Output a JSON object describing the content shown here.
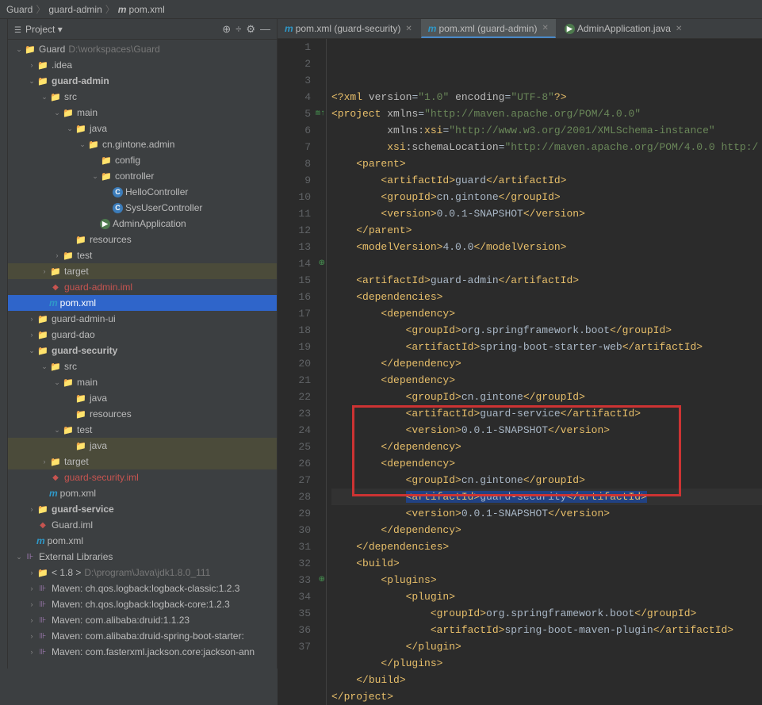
{
  "breadcrumb": {
    "parts": [
      "Guard",
      "guard-admin",
      "pom.xml"
    ]
  },
  "panel": {
    "title": "Project",
    "icons": [
      "target",
      "sync",
      "gear",
      "minimize"
    ]
  },
  "tree": [
    {
      "d": 0,
      "arrow": "v",
      "icon": "folder-blue",
      "label": "Guard",
      "dim": "D:\\workspaces\\Guard"
    },
    {
      "d": 1,
      "arrow": ">",
      "icon": "folder",
      "label": ".idea"
    },
    {
      "d": 1,
      "arrow": "v",
      "icon": "folder-blue",
      "label": "guard-admin",
      "bold": true
    },
    {
      "d": 2,
      "arrow": "v",
      "icon": "folder-blue",
      "label": "src"
    },
    {
      "d": 3,
      "arrow": "v",
      "icon": "folder-blue",
      "label": "main"
    },
    {
      "d": 4,
      "arrow": "v",
      "icon": "folder-blue",
      "label": "java"
    },
    {
      "d": 5,
      "arrow": "v",
      "icon": "folder",
      "label": "cn.gintone.admin"
    },
    {
      "d": 6,
      "arrow": "",
      "icon": "folder",
      "label": "config"
    },
    {
      "d": 6,
      "arrow": "v",
      "icon": "folder",
      "label": "controller"
    },
    {
      "d": 7,
      "arrow": "",
      "icon": "class-blue",
      "label": "HelloController"
    },
    {
      "d": 7,
      "arrow": "",
      "icon": "class-blue",
      "label": "SysUserController"
    },
    {
      "d": 6,
      "arrow": "",
      "icon": "class-green",
      "label": "AdminApplication"
    },
    {
      "d": 4,
      "arrow": "",
      "icon": "folder",
      "label": "resources"
    },
    {
      "d": 3,
      "arrow": ">",
      "icon": "folder-blue",
      "label": "test"
    },
    {
      "d": 2,
      "arrow": ">",
      "icon": "folder-orange",
      "label": "target",
      "hl": true
    },
    {
      "d": 2,
      "arrow": "",
      "icon": "iml",
      "label": "guard-admin.iml",
      "color": "#c75450"
    },
    {
      "d": 2,
      "arrow": "",
      "icon": "m",
      "label": "pom.xml",
      "selected": true
    },
    {
      "d": 1,
      "arrow": ">",
      "icon": "folder-blue",
      "label": "guard-admin-ui"
    },
    {
      "d": 1,
      "arrow": ">",
      "icon": "folder-blue",
      "label": "guard-dao"
    },
    {
      "d": 1,
      "arrow": "v",
      "icon": "folder-blue",
      "label": "guard-security",
      "bold": true
    },
    {
      "d": 2,
      "arrow": "v",
      "icon": "folder-blue",
      "label": "src"
    },
    {
      "d": 3,
      "arrow": "v",
      "icon": "folder-blue",
      "label": "main"
    },
    {
      "d": 4,
      "arrow": "",
      "icon": "folder-blue",
      "label": "java"
    },
    {
      "d": 4,
      "arrow": "",
      "icon": "folder",
      "label": "resources"
    },
    {
      "d": 3,
      "arrow": "v",
      "icon": "folder-blue",
      "label": "test"
    },
    {
      "d": 4,
      "arrow": "",
      "icon": "folder-blue",
      "label": "java",
      "hl": true
    },
    {
      "d": 2,
      "arrow": ">",
      "icon": "folder-orange",
      "label": "target",
      "hl": true
    },
    {
      "d": 2,
      "arrow": "",
      "icon": "iml",
      "label": "guard-security.iml",
      "color": "#c75450"
    },
    {
      "d": 2,
      "arrow": "",
      "icon": "m",
      "label": "pom.xml"
    },
    {
      "d": 1,
      "arrow": ">",
      "icon": "folder-blue",
      "label": "guard-service",
      "bold": true
    },
    {
      "d": 1,
      "arrow": "",
      "icon": "iml",
      "label": "Guard.iml"
    },
    {
      "d": 1,
      "arrow": "",
      "icon": "m",
      "label": "pom.xml"
    },
    {
      "d": 0,
      "arrow": "v",
      "icon": "lib",
      "label": "External Libraries"
    },
    {
      "d": 1,
      "arrow": ">",
      "icon": "folder",
      "label": "< 1.8 >",
      "dim": "D:\\program\\Java\\jdk1.8.0_111"
    },
    {
      "d": 1,
      "arrow": ">",
      "icon": "lib",
      "label": "Maven: ch.qos.logback:logback-classic:1.2.3"
    },
    {
      "d": 1,
      "arrow": ">",
      "icon": "lib",
      "label": "Maven: ch.qos.logback:logback-core:1.2.3"
    },
    {
      "d": 1,
      "arrow": ">",
      "icon": "lib",
      "label": "Maven: com.alibaba:druid:1.1.23"
    },
    {
      "d": 1,
      "arrow": ">",
      "icon": "lib",
      "label": "Maven: com.alibaba:druid-spring-boot-starter:"
    },
    {
      "d": 1,
      "arrow": ">",
      "icon": "lib",
      "label": "Maven: com.fasterxml.jackson.core:jackson-ann"
    }
  ],
  "tabs": [
    {
      "icon": "m",
      "label": "pom.xml (guard-security)",
      "active": false
    },
    {
      "icon": "m",
      "label": "pom.xml (guard-admin)",
      "active": true
    },
    {
      "icon": "class-green",
      "label": "AdminApplication.java",
      "active": false
    }
  ],
  "code": {
    "lines": [
      {
        "n": 1,
        "h": "<span class='tag'>&lt;?xml</span> <span class='attr'>version</span>=<span class='str'>\"1.0\"</span> <span class='attr'>encoding</span>=<span class='str'>\"UTF-8\"</span><span class='tag'>?&gt;</span>"
      },
      {
        "n": 2,
        "h": "<span class='tag'>&lt;project</span> <span class='attr'>xmlns</span>=<span class='str'>\"http://maven.apache.org/POM/4.0.0\"</span>"
      },
      {
        "n": 3,
        "h": "         <span class='attr'>xmlns:</span><span class='tag'>xsi</span>=<span class='str'>\"http://www.w3.org/2001/XMLSchema-instance\"</span>"
      },
      {
        "n": 4,
        "h": "         <span class='tag'>xsi</span><span class='attr'>:schemaLocation</span>=<span class='str'>\"http://maven.apache.org/POM/4.0.0 http:/</span>"
      },
      {
        "n": 5,
        "h": "    <span class='tag'>&lt;parent&gt;</span>",
        "marker": "m↑"
      },
      {
        "n": 6,
        "h": "        <span class='tag'>&lt;artifactId&gt;</span>guard<span class='tag'>&lt;/artifactId&gt;</span>"
      },
      {
        "n": 7,
        "h": "        <span class='tag'>&lt;groupId&gt;</span>cn.gintone<span class='tag'>&lt;/groupId&gt;</span>"
      },
      {
        "n": 8,
        "h": "        <span class='tag'>&lt;version&gt;</span>0.0.1-SNAPSHOT<span class='tag'>&lt;/version&gt;</span>"
      },
      {
        "n": 9,
        "h": "    <span class='tag'>&lt;/parent&gt;</span>"
      },
      {
        "n": 10,
        "h": "    <span class='tag'>&lt;modelVersion&gt;</span>4.0.0<span class='tag'>&lt;/modelVersion&gt;</span>"
      },
      {
        "n": 11,
        "h": ""
      },
      {
        "n": 12,
        "h": "    <span class='tag'>&lt;artifactId&gt;</span>guard-admin<span class='tag'>&lt;/artifactId&gt;</span>"
      },
      {
        "n": 13,
        "h": "    <span class='tag'>&lt;dependencies&gt;</span>"
      },
      {
        "n": 14,
        "h": "        <span class='tag'>&lt;dependency&gt;</span>",
        "marker": "⊕"
      },
      {
        "n": 15,
        "h": "            <span class='tag'>&lt;groupId&gt;</span>org.springframework.boot<span class='tag'>&lt;/groupId&gt;</span>"
      },
      {
        "n": 16,
        "h": "            <span class='tag'>&lt;artifactId&gt;</span>spring-boot-starter-web<span class='tag'>&lt;/artifactId&gt;</span>"
      },
      {
        "n": 17,
        "h": "        <span class='tag'>&lt;/dependency&gt;</span>"
      },
      {
        "n": 18,
        "h": "        <span class='tag'>&lt;dependency&gt;</span>"
      },
      {
        "n": 19,
        "h": "            <span class='tag'>&lt;groupId&gt;</span>cn.gintone<span class='tag'>&lt;/groupId&gt;</span>"
      },
      {
        "n": 20,
        "h": "            <span class='tag'>&lt;artifactId&gt;</span>guard-service<span class='tag'>&lt;/artifactId&gt;</span>"
      },
      {
        "n": 21,
        "h": "            <span class='tag'>&lt;version&gt;</span>0.0.1-SNAPSHOT<span class='tag'>&lt;/version&gt;</span>"
      },
      {
        "n": 22,
        "h": "        <span class='tag'>&lt;/dependency&gt;</span>"
      },
      {
        "n": 23,
        "h": "        <span class='tag'>&lt;dependency&gt;</span>"
      },
      {
        "n": 24,
        "h": "            <span class='tag'>&lt;groupId&gt;</span>cn.gintone<span class='tag'>&lt;/groupId&gt;</span>"
      },
      {
        "n": 25,
        "h": "            <span class='sel'><span class='tag'>&lt;artifactId&gt;</span>guard-security<span class='tag'>&lt;/artifactId&gt;</span></span>",
        "caret": true
      },
      {
        "n": 26,
        "h": "            <span class='tag'>&lt;version&gt;</span>0.0.1-SNAPSHOT<span class='tag'>&lt;/version&gt;</span>"
      },
      {
        "n": 27,
        "h": "        <span class='tag'>&lt;/dependency&gt;</span>"
      },
      {
        "n": 28,
        "h": "    <span class='tag'>&lt;/dependencies&gt;</span>"
      },
      {
        "n": 29,
        "h": "    <span class='tag'>&lt;build&gt;</span>"
      },
      {
        "n": 30,
        "h": "        <span class='tag'>&lt;plugins&gt;</span>"
      },
      {
        "n": 31,
        "h": "            <span class='tag'>&lt;plugin&gt;</span>"
      },
      {
        "n": 32,
        "h": "                <span class='tag'>&lt;groupId&gt;</span>org.springframework.boot<span class='tag'>&lt;/groupId&gt;</span>"
      },
      {
        "n": 33,
        "h": "                <span class='tag'>&lt;artifactId&gt;</span>spring-boot-maven-plugin<span class='tag'>&lt;/artifactId&gt;</span>",
        "marker": "⊕"
      },
      {
        "n": 34,
        "h": "            <span class='tag'>&lt;/plugin&gt;</span>"
      },
      {
        "n": 35,
        "h": "        <span class='tag'>&lt;/plugins&gt;</span>"
      },
      {
        "n": 36,
        "h": "    <span class='tag'>&lt;/build&gt;</span>"
      },
      {
        "n": 37,
        "h": "<span class='tag'>&lt;/project&gt;</span>"
      }
    ]
  }
}
